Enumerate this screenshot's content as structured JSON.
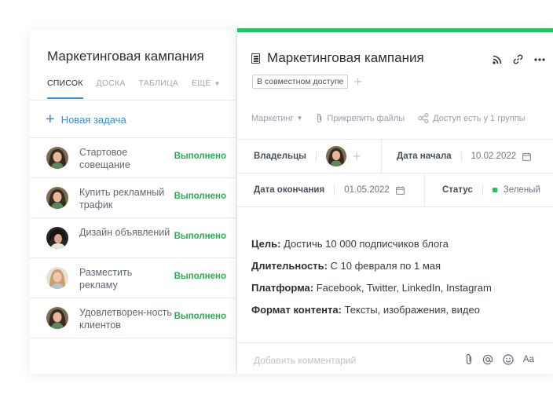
{
  "left": {
    "title": "Маркетинговая кампания",
    "tabs": [
      {
        "label": "СПИСОК"
      },
      {
        "label": "ДОСКА"
      },
      {
        "label": "ТАБЛИЦА"
      },
      {
        "label": "ЕЩЕ"
      }
    ],
    "new_task": "Новая задача",
    "tasks": [
      {
        "name": "Стартовое совещание",
        "status": "Выполнено"
      },
      {
        "name": "Купить рекламный трафик",
        "status": "Выполнено"
      },
      {
        "name": "Дизайн объявлений",
        "status": "Выполнено"
      },
      {
        "name": "Разместить рекламу",
        "status": "Выполнено"
      },
      {
        "name": "Удовлетворен-ность клиентов",
        "status": "Выполнено"
      }
    ]
  },
  "right": {
    "title": "Маркетинговая кампания",
    "share_badge": "В совместном доступе",
    "meta": {
      "folder": "Маркетинг",
      "attach": "Прикрепить файлы",
      "access": "Доступ есть у 1 группы"
    },
    "fields": {
      "owners_label": "Владельцы",
      "start_label": "Дата начала",
      "start_value": "10.02.2022",
      "end_label": "Дата окончания",
      "end_value": "01.05.2022",
      "status_label": "Статус",
      "status_value": "Зеленый"
    },
    "description": [
      {
        "label": "Цель:",
        "text": " Достичь 10 000 подписчиков блога"
      },
      {
        "label": "Длительность:",
        "text": " С 10 февраля по 1 мая"
      },
      {
        "label": "Платформа:",
        "text": " Facebook, Twitter, LinkedIn, Instagram"
      },
      {
        "label": "Формат контента:",
        "text": " Тексты, изображения, видео"
      }
    ],
    "comment_placeholder": "Добавить комментарий",
    "text_format_label": "Aa"
  },
  "colors": {
    "accent_blue": "#2f8de4",
    "done_green": "#23b24e",
    "top_bar_green": "#22c55e"
  }
}
